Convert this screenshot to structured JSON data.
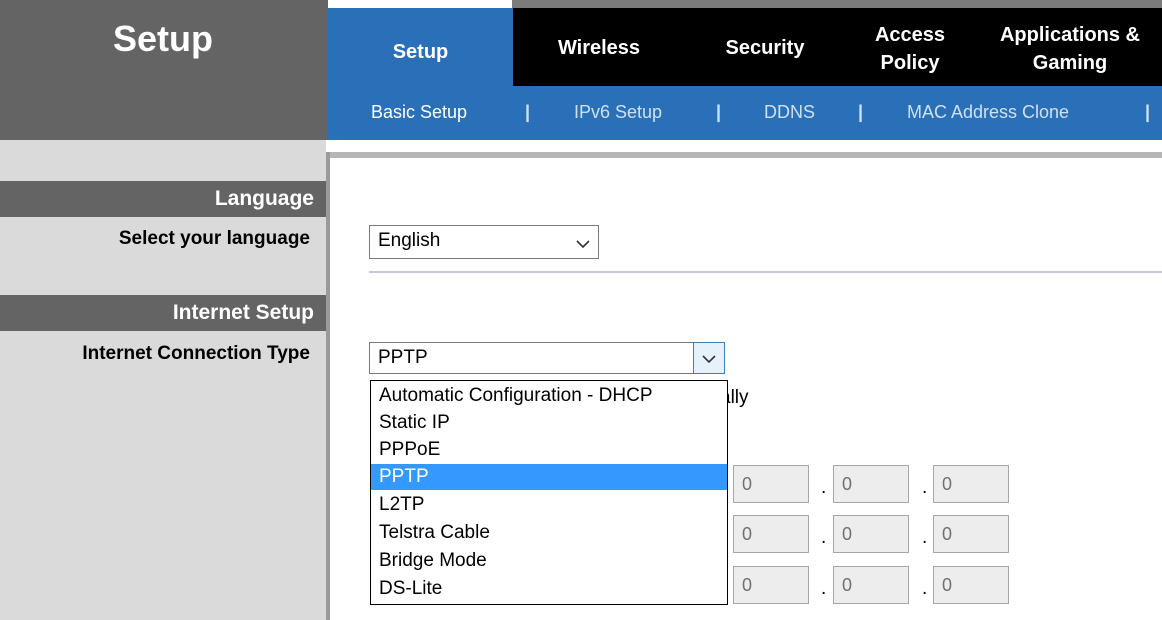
{
  "header": {
    "brand": "Setup",
    "tabs": [
      {
        "label": "Setup",
        "active": true
      },
      {
        "label": "Wireless"
      },
      {
        "label": "Security"
      },
      {
        "label_line1": "Access",
        "label_line2": "Policy"
      },
      {
        "label_line1": "Applications &",
        "label_line2": "Gaming"
      }
    ],
    "subnav": {
      "items": [
        "Basic Setup",
        "IPv6 Setup",
        "DDNS",
        "MAC Address Clone"
      ],
      "separator": "|"
    }
  },
  "language": {
    "section_title": "Language",
    "field_label": "Select your language",
    "selected": "English"
  },
  "internet_setup": {
    "section_title": "Internet Setup",
    "field_label": "Internet Connection Type",
    "selected": "PPTP",
    "options": [
      "Automatic Configuration - DHCP",
      "Static IP",
      "PPPoE",
      "PPTP",
      "L2TP",
      "Telstra Cable",
      "Bridge Mode",
      "DS-Lite"
    ],
    "highlighted_option": "PPTP",
    "partial_text": "ally",
    "ip_rows": [
      [
        "0",
        "0",
        "0"
      ],
      [
        "0",
        "0",
        "0"
      ],
      [
        "0",
        "0",
        "0"
      ]
    ],
    "ip_separator": "."
  },
  "colors": {
    "accent_blue": "#2a70b8",
    "header_gray": "#646464",
    "highlight": "#3399ff"
  }
}
